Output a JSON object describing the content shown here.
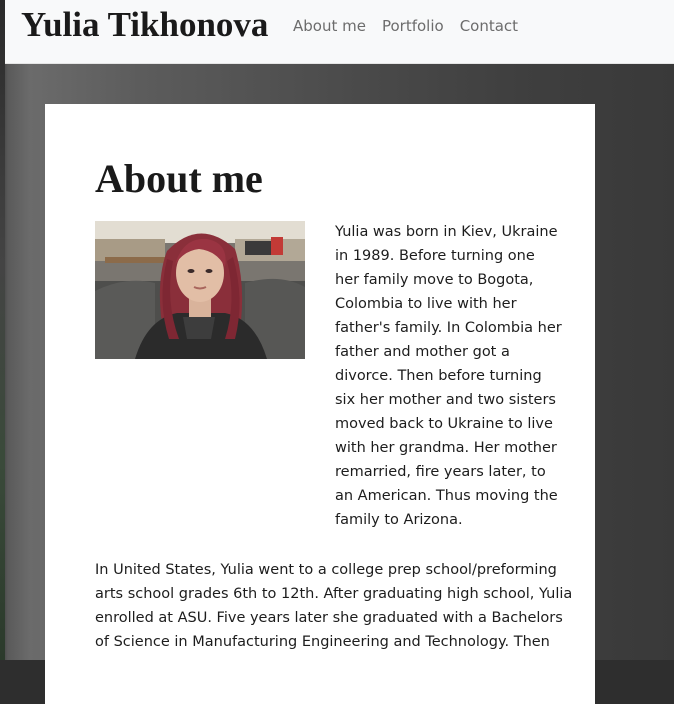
{
  "header": {
    "brand": "Yulia Tikhonova",
    "nav": [
      "About me",
      "Portfolio",
      "Contact"
    ]
  },
  "main": {
    "title": "About me",
    "photo_alt": "portrait-photo",
    "bio_lines": [
      "Yulia was born in Kiev, Ukraine",
      "in 1989. Before turning one",
      "her family move to Bogota,",
      "Colombia to live with her",
      "father's family. In Colombia her",
      "father and mother got a",
      "divorce. Then before turning",
      "six her mother and two sisters",
      "moved back to Ukraine to live",
      "with her grandma. Her mother",
      "remarried, fire years later, to",
      "an American. Thus moving the",
      "family to Arizona."
    ],
    "para2_lines": [
      "In United States, Yulia went to a college prep school/preforming",
      "arts school grades 6th to 12th. After graduating high school, Yulia",
      "enrolled at ASU. Five years later she graduated with a Bachelors",
      "of Science in Manufacturing Engineering and Technology. Then"
    ]
  },
  "colors": {
    "navbar_bg": "#f8f9fa",
    "nav_link": "#6c6c6c",
    "page_bg": "#3f3f3f",
    "card_bg": "#ffffff"
  }
}
